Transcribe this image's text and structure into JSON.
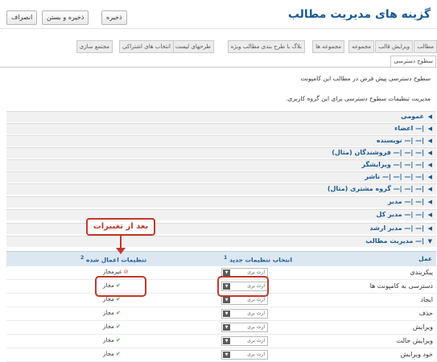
{
  "header": {
    "title": "گزینه های مدیریت مطالب",
    "buttons": {
      "save": "ذخیره",
      "save_close": "ذخیره و بستن",
      "cancel": "انصراف"
    }
  },
  "tabs": [
    "مطالب",
    "ویرایش قالب",
    "مجموعه",
    "مجموعه ها",
    "بلاگ با طرح بندی مطالب ویژه",
    "طرحهای لیست",
    "انتخاب های اشتراکی",
    "مجتمع سازی"
  ],
  "active_subtab": "سطوح دسترسی",
  "descriptions": {
    "line1": "سطوح دسترسی پیش فرض در مطالب این کامپونت",
    "line2": "مدیریت تنظیمات سطوح دسترسی برای این گروه کاربری."
  },
  "groups": [
    "عمومی",
    "|— اعضاء",
    "|— |— نویسنده",
    "|— |— |— فروشندگان (مثال)",
    "|— |— |— ویرایشگر",
    "|— |— |— |— ناشر",
    "|— |— |— گروه مشتری (مثال)",
    "|— |— مدیر",
    "|— |— مدیر کل",
    "|— |— مدیر ارشد",
    "|— مدیریت مطالب"
  ],
  "table": {
    "col_action": "عمل",
    "col_new": "انتخاب تنظیمات جدید",
    "col_new_sup": "1",
    "col_calc": "تنظیمات اعمال شده",
    "col_calc_sup": "2",
    "rows": [
      {
        "action": "پیکربندی",
        "select": "ارث بری",
        "status": "غیرمجاز",
        "allowed": false
      },
      {
        "action": "دسترسی به کامپونت ها",
        "select": "ارث بری",
        "status": "مجاز",
        "allowed": true
      },
      {
        "action": "ایجاد",
        "select": "ارث بری",
        "status": "مجاز",
        "allowed": true
      },
      {
        "action": "حذف",
        "select": "ارث بری",
        "status": "مجاز",
        "allowed": true
      },
      {
        "action": "ویرایش",
        "select": "ارث بری",
        "status": "مجاز",
        "allowed": true
      },
      {
        "action": "ویرایش حالت",
        "select": "ارث بری",
        "status": "مجاز",
        "allowed": true
      },
      {
        "action": "خود ویرایش",
        "select": "ارث بری",
        "status": "مجاز",
        "allowed": true
      }
    ]
  },
  "annotation": {
    "callout": "بعد از تغییرات",
    "color": "#c0392b"
  },
  "icons": {
    "group_arrow": "triangle-left-icon",
    "allowed": "check-icon",
    "denied": "deny-icon",
    "dropdown": "dropdown-icon"
  }
}
